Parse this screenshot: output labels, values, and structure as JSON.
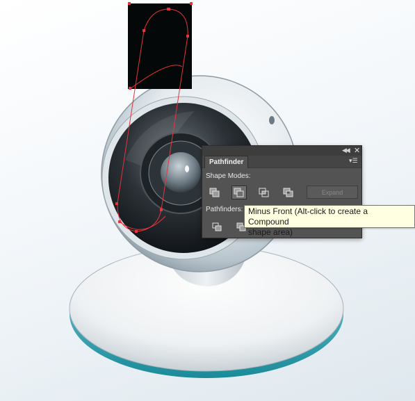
{
  "panel": {
    "collapse_icon": "collapse-double-arrow-icon",
    "close_icon": "close-icon",
    "tab_label": "Pathfinder",
    "menu_icon": "panel-menu-icon",
    "shape_modes_label": "Shape Modes:",
    "shape_modes": [
      {
        "name": "Unite",
        "icon": "unite-icon",
        "active": false
      },
      {
        "name": "Minus Front",
        "icon": "minus-front-icon",
        "active": true
      },
      {
        "name": "Intersect",
        "icon": "intersect-icon",
        "active": false
      },
      {
        "name": "Exclude",
        "icon": "exclude-icon",
        "active": false
      }
    ],
    "expand_label": "Expand",
    "pathfinders_label": "Pathfinders:"
  },
  "tooltip": {
    "line1": "Minus Front (Alt-click to create a Compound",
    "line2": "shape area)"
  },
  "colors": {
    "panel_bg": "#535353",
    "path_selection": "#e8333d",
    "base_rim": "#2aa3b3",
    "black_shape": "#050808"
  }
}
